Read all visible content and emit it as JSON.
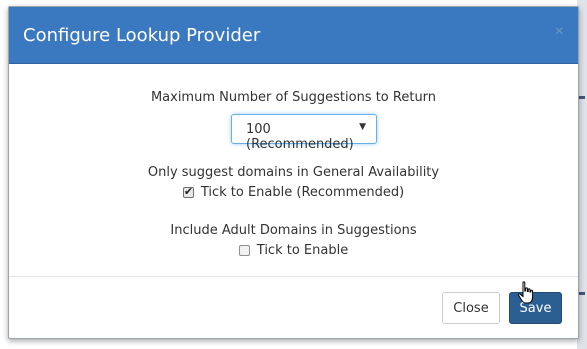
{
  "dialog": {
    "title": "Configure Lookup Provider",
    "close_glyph": "×"
  },
  "fields": {
    "max_suggestions": {
      "label": "Maximum Number of Suggestions to Return",
      "selected": "100 (Recommended)"
    },
    "general_availability": {
      "label": "Only suggest domains in General Availability",
      "checkbox_label": "Tick to Enable (Recommended)",
      "checked": true
    },
    "adult_domains": {
      "label": "Include Adult Domains in Suggestions",
      "checkbox_label": "Tick to Enable",
      "checked": false
    }
  },
  "footer": {
    "close_label": "Close",
    "save_label": "Save"
  },
  "colors": {
    "header": "#3a78bf",
    "save_button": "#2b5f91"
  },
  "icons": {
    "select_caret": "caret-down-icon",
    "pointer": "hand-pointer-icon",
    "check": "checkmark-icon"
  }
}
